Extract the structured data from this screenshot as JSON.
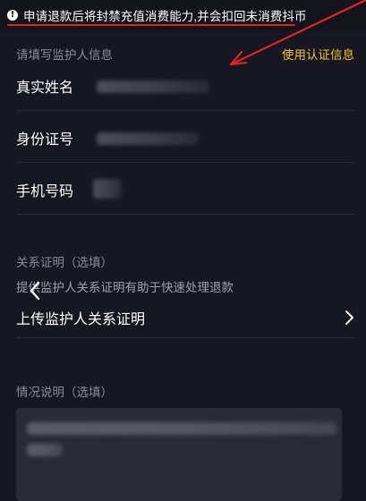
{
  "warning": {
    "icon": "exclamation-icon",
    "text": "申请退款后将封禁充值消费能力,并会扣回未消费抖币"
  },
  "guardian_section": {
    "title": "请填写监护人信息",
    "use_verified_link": "使用认证信息"
  },
  "fields": [
    {
      "label": "真实姓名",
      "value": ""
    },
    {
      "label": "身份证号",
      "value": ""
    },
    {
      "label": "手机号码",
      "value": ""
    }
  ],
  "relation": {
    "title": "关系证明（选填）",
    "hint": "提供监护人关系证明有助于快速处理退款",
    "upload_label": "上传监护人关系证明"
  },
  "situation": {
    "title": "情况说明（选填）",
    "value": ""
  },
  "colors": {
    "accent_gold": "#f2c230",
    "warning_underline": "#e02424",
    "background": "#161721"
  }
}
